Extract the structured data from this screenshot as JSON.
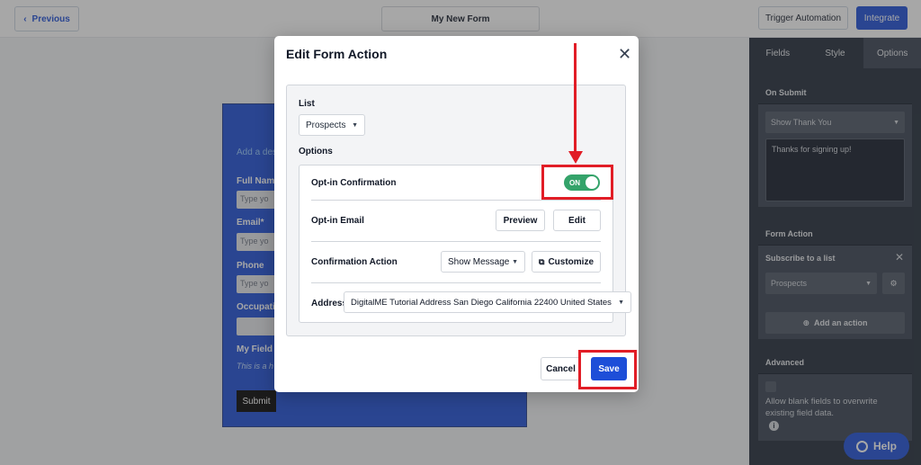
{
  "topbar": {
    "previous_label": "Previous",
    "form_title": "My New Form",
    "trigger_label": "Trigger Automation",
    "integrate_label": "Integrate"
  },
  "preview": {
    "description": "Add a des",
    "fields": [
      {
        "label": "Full Nam",
        "placeholder": "Type yo"
      },
      {
        "label": "Email*",
        "placeholder": "Type yo"
      },
      {
        "label": "Phone",
        "placeholder": "Type yo"
      },
      {
        "label": "Occupati",
        "placeholder": ""
      }
    ],
    "my_field_label": "My Field",
    "my_field_help": "This is a h",
    "submit_label": "Submit"
  },
  "right_panel": {
    "tabs": [
      "Fields",
      "Style",
      "Options"
    ],
    "active_tab": "Options",
    "on_submit": {
      "heading": "On Submit",
      "select_value": "Show Thank You",
      "message": "Thanks for signing up!"
    },
    "form_action": {
      "heading": "Form Action",
      "item_title": "Subscribe to a list",
      "list_value": "Prospects",
      "add_action_label": "Add an action"
    },
    "advanced": {
      "heading": "Advanced",
      "blank_fields_label": "Allow blank fields to overwrite existing field data."
    }
  },
  "help_label": "Help",
  "modal": {
    "title": "Edit Form Action",
    "list_label": "List",
    "list_value": "Prospects",
    "options_label": "Options",
    "optin_confirmation_label": "Opt-in Confirmation",
    "toggle_label": "ON",
    "optin_email_label": "Opt-in Email",
    "preview_label": "Preview",
    "edit_label": "Edit",
    "confirmation_action_label": "Confirmation Action",
    "confirmation_action_value": "Show Message",
    "customize_label": "Customize",
    "address_label": "Address",
    "address_value": "DigitalME Tutorial Address San Diego California 22400 United States",
    "cancel_label": "Cancel",
    "save_label": "Save"
  },
  "colors": {
    "primary": "#1d4ed8",
    "toggle_on": "#34a36a",
    "annotation": "#e11d26",
    "panel_dark": "#1f2937"
  }
}
